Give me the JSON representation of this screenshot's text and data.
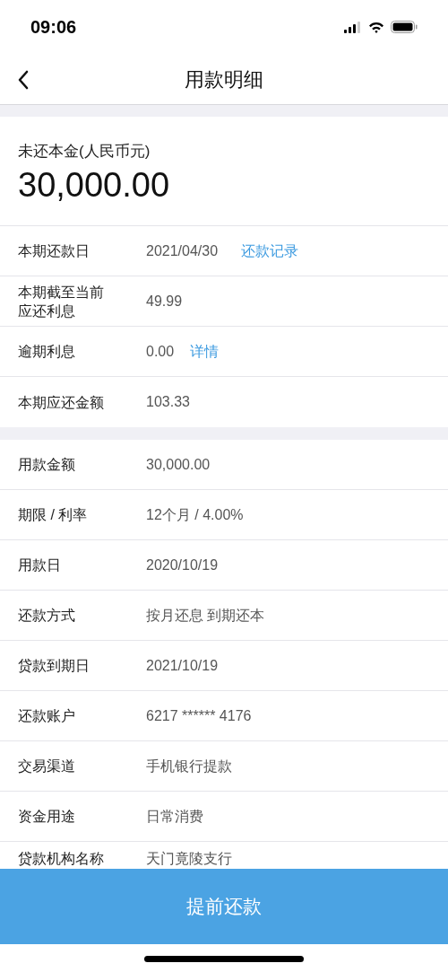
{
  "status_bar": {
    "time": "09:06"
  },
  "nav": {
    "title": "用款明细"
  },
  "principal": {
    "label": "未还本金(人民币元)",
    "amount": "30,000.00"
  },
  "sections": [
    {
      "rows": [
        {
          "label": "本期还款日",
          "value": "2021/04/30",
          "link": "还款记录"
        },
        {
          "label": "本期截至当前应还利息",
          "value": "49.99"
        },
        {
          "label": "逾期利息",
          "value": "0.00",
          "link": "详情"
        },
        {
          "label": "本期应还金额",
          "value": "103.33"
        }
      ]
    },
    {
      "rows": [
        {
          "label": "用款金额",
          "value": "30,000.00"
        },
        {
          "label": "期限 / 利率",
          "value": "12个月 / 4.00%"
        },
        {
          "label": "用款日",
          "value": "2020/10/19"
        },
        {
          "label": "还款方式",
          "value": "按月还息 到期还本"
        },
        {
          "label": "贷款到期日",
          "value": "2021/10/19"
        },
        {
          "label": "还款账户",
          "value": "6217 ****** 4176"
        },
        {
          "label": "交易渠道",
          "value": "手机银行提款"
        },
        {
          "label": "资金用途",
          "value": "日常消费"
        },
        {
          "label": "贷款机构名称",
          "value": "天门竟陵支行"
        }
      ]
    }
  ],
  "button": {
    "label": "提前还款"
  }
}
